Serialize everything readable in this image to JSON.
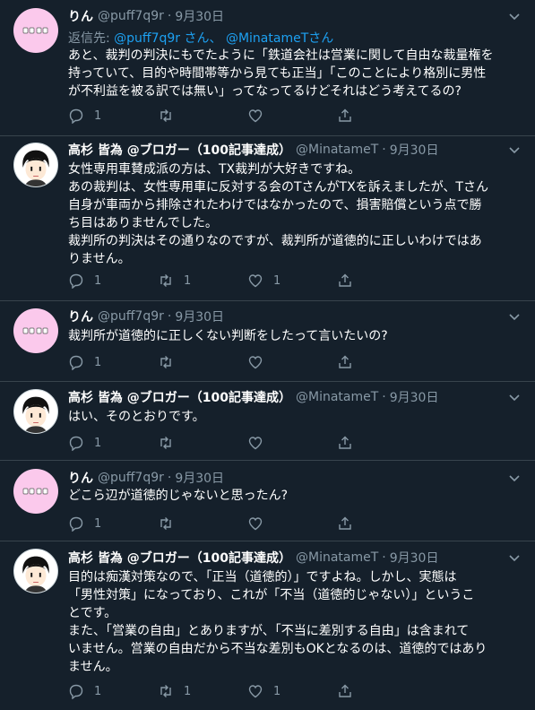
{
  "colors": {
    "background": "#15202b",
    "text": "#ffffff",
    "secondary": "#8899a6",
    "link": "#1da1f2",
    "divider": "#38444d"
  },
  "tweets": [
    {
      "author": "りん",
      "handle": "@puff7q9r",
      "dot": "·",
      "date": "9月30日",
      "avatar": "rin-avatar",
      "reply_prefix": "返信先:",
      "reply_mention1": "@puff7q9r",
      "reply_san1": "さん、",
      "reply_mention2": "@MinatameT",
      "reply_san2": "さん",
      "lines": [
        "あと、裁判の判決にもでたように「鉄道会社は営業に関して自由な裁量権を",
        "持っていて、目的や時間帯等から見ても正当」「このことにより格別に男性",
        "が不利益を被る訳では無い」ってなってるけどそれはどう考えてるの?"
      ],
      "reply_count": "1",
      "retweet_count": "",
      "like_count": ""
    },
    {
      "author": "高杉 皆為 @ブロガー（100記事達成）",
      "handle": "@MinatameT",
      "dot": "·",
      "date": "9月30日",
      "avatar": "takasugi-avatar",
      "lines": [
        "女性専用車賛成派の方は、TX裁判が大好きですね。",
        "あの裁判は、女性専用車に反対する会のTさんがTXを訴えましたが、Tさん",
        "自身が車両から排除されたわけではなかったので、損害賠償という点で勝",
        "ち目はありませんでした。",
        "裁判所の判決はその通りなのですが、裁判所が道徳的に正しいわけではあ",
        "りません。"
      ],
      "reply_count": "1",
      "retweet_count": "1",
      "like_count": "1"
    },
    {
      "author": "りん",
      "handle": "@puff7q9r",
      "dot": "·",
      "date": "9月30日",
      "avatar": "rin-avatar",
      "lines": [
        "裁判所が道徳的に正しくない判断をしたって言いたいの?"
      ],
      "reply_count": "1",
      "retweet_count": "",
      "like_count": ""
    },
    {
      "author": "高杉 皆為 @ブロガー（100記事達成）",
      "handle": "@MinatameT",
      "dot": "·",
      "date": "9月30日",
      "avatar": "takasugi-avatar",
      "lines": [
        "はい、そのとおりです。"
      ],
      "reply_count": "1",
      "retweet_count": "",
      "like_count": ""
    },
    {
      "author": "りん",
      "handle": "@puff7q9r",
      "dot": "·",
      "date": "9月30日",
      "avatar": "rin-avatar",
      "lines": [
        "どこら辺が道徳的じゃないと思ったん?"
      ],
      "reply_count": "1",
      "retweet_count": "",
      "like_count": ""
    },
    {
      "author": "高杉 皆為 @ブロガー（100記事達成）",
      "handle": "@MinatameT",
      "dot": "·",
      "date": "9月30日",
      "avatar": "takasugi-avatar",
      "lines": [
        "目的は痴漢対策なので、「正当（道徳的）」ですよね。しかし、実態は",
        "「男性対策」になっており、これが「不当（道徳的じゃない）」というこ",
        "とです。",
        "また、「営業の自由」とありますが、「不当に差別する自由」は含まれて",
        "いません。営業の自由だから不当な差別もOKとなるのは、道徳的ではあり",
        "ません。"
      ],
      "reply_count": "1",
      "retweet_count": "1",
      "like_count": "1"
    }
  ]
}
